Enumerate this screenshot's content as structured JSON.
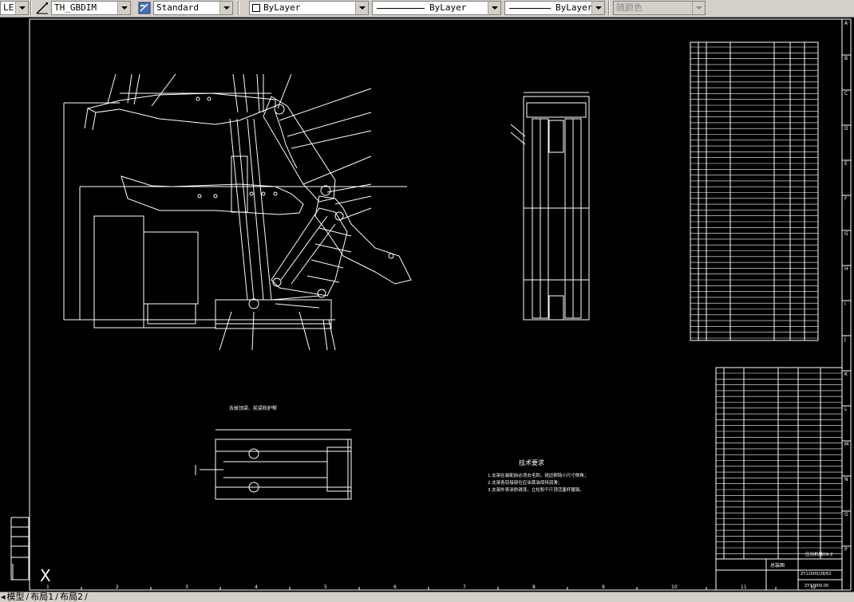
{
  "toolbar": {
    "layer_value": "LE",
    "dimstyle_value": "TH_GBDIM",
    "textstyle_value": "Standard",
    "color_value": "ByLayer",
    "linetype_value": "ByLayer",
    "lineweight_value": "ByLayer",
    "plotstyle_value": "随颜色",
    "icons": [
      "dimension-style-icon",
      "text-style-icon"
    ]
  },
  "drawing": {
    "background_color": "#000000",
    "line_color": "#ffffff",
    "top_view_caption": "去掉顶梁、前梁和护帮",
    "tech_req_title": "技术要求",
    "tech_req_lines": [
      "1.支架在装配前必须去毛刺，锐边倒钝小尺寸倒角；",
      "2.支架各铰接部位应涂黄油保持润滑；",
      "3.支架外表涂防锈漆，立柱和千斤顶活塞杆镀铬。"
    ],
    "title_block_name": "总装图",
    "title_block_company": "应用机器09-2",
    "drawing_number_1": "ZY12000/28/62",
    "drawing_number_2": "ZY12000.00",
    "border_rows": [
      "A",
      "B",
      "C",
      "D",
      "E",
      "F",
      "G",
      "H",
      "I",
      "J",
      "K",
      "L",
      "M",
      "N",
      "O",
      "P"
    ],
    "border_cols": [
      "1",
      "2",
      "3",
      "4",
      "5",
      "6",
      "7",
      "8",
      "9",
      "10",
      "11",
      "12"
    ],
    "ucs_label": "X"
  },
  "tabs": {
    "model": "模型",
    "layout1": "布局1",
    "layout2": "布局2"
  }
}
